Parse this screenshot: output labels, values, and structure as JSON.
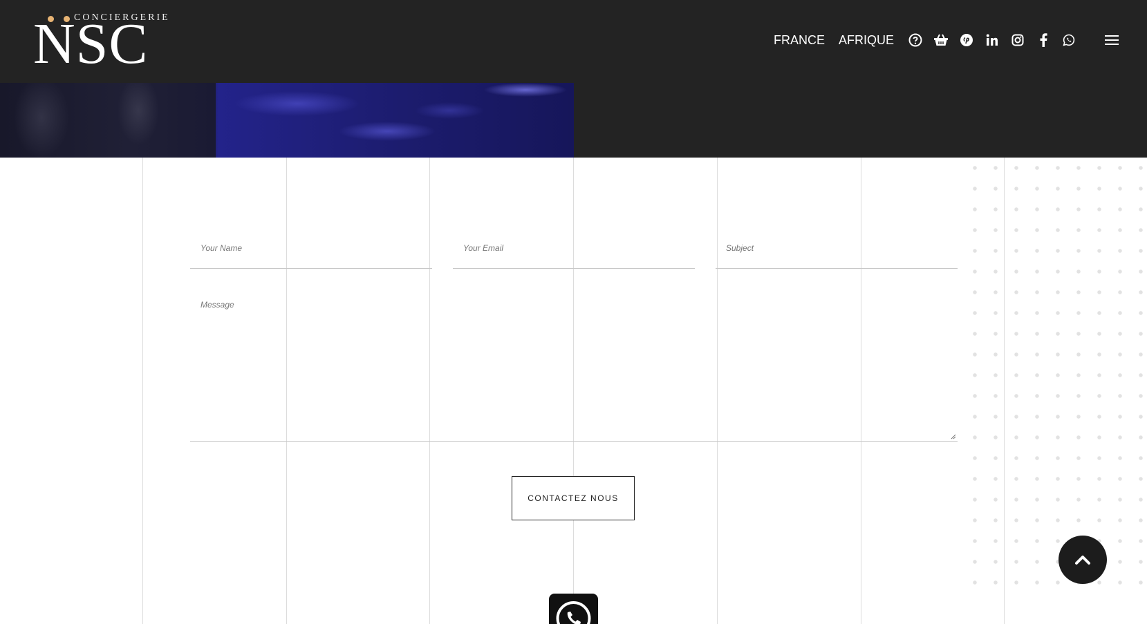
{
  "header": {
    "logo": {
      "tagline": "CONCIERGERIE",
      "brand": "NSC",
      "dot_color": "#e8b474"
    },
    "nav": {
      "links": [
        "FRANCE",
        "AFRIQUE"
      ],
      "icons": [
        "help-icon",
        "basket-icon",
        "pinterest-icon",
        "linkedin-icon",
        "instagram-icon",
        "facebook-icon",
        "whatsapp-icon",
        "menu-icon"
      ]
    },
    "background": "#232323"
  },
  "form": {
    "name_placeholder": "Your Name",
    "email_placeholder": "Your Email",
    "subject_placeholder": "Subject",
    "message_placeholder": "Message",
    "submit_label": "CONTACTEZ NOUS"
  },
  "floating": {
    "whatsapp": "whatsapp-icon",
    "back_to_top": "chevron-up-icon"
  }
}
